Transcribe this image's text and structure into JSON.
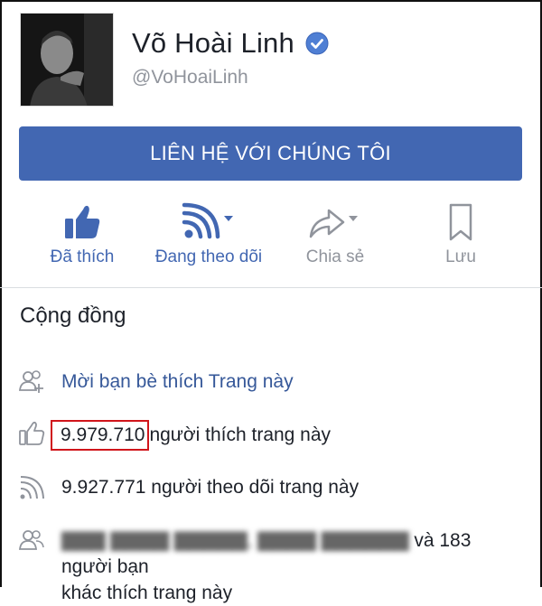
{
  "page": {
    "name": "Võ Hoài Linh",
    "handle": "@VoHoaiLinh"
  },
  "contact_button": "LIÊN HỆ VỚI CHÚNG TÔI",
  "actions": [
    {
      "label": "Đã thích",
      "icon": "thumbs-up-icon",
      "state": "active"
    },
    {
      "label": "Đang theo dõi",
      "icon": "follow-rss-icon",
      "state": "active"
    },
    {
      "label": "Chia sẻ",
      "icon": "share-icon",
      "state": "inactive"
    },
    {
      "label": "Lưu",
      "icon": "bookmark-icon",
      "state": "inactive"
    }
  ],
  "community": {
    "title": "Cộng đồng",
    "invite": "Mời bạn bè thích Trang này",
    "likes_count": "9.979.710",
    "likes_suffix": "người thích trang này",
    "follows_count": "9.927.771",
    "follows_suffix": "người theo dõi trang này",
    "friends_line1": "và 183 người bạn",
    "friends_line2": "khác thích trang này"
  },
  "colors": {
    "accent": "#4267b2",
    "muted": "#90949c",
    "highlight_box": "#d0151b"
  }
}
